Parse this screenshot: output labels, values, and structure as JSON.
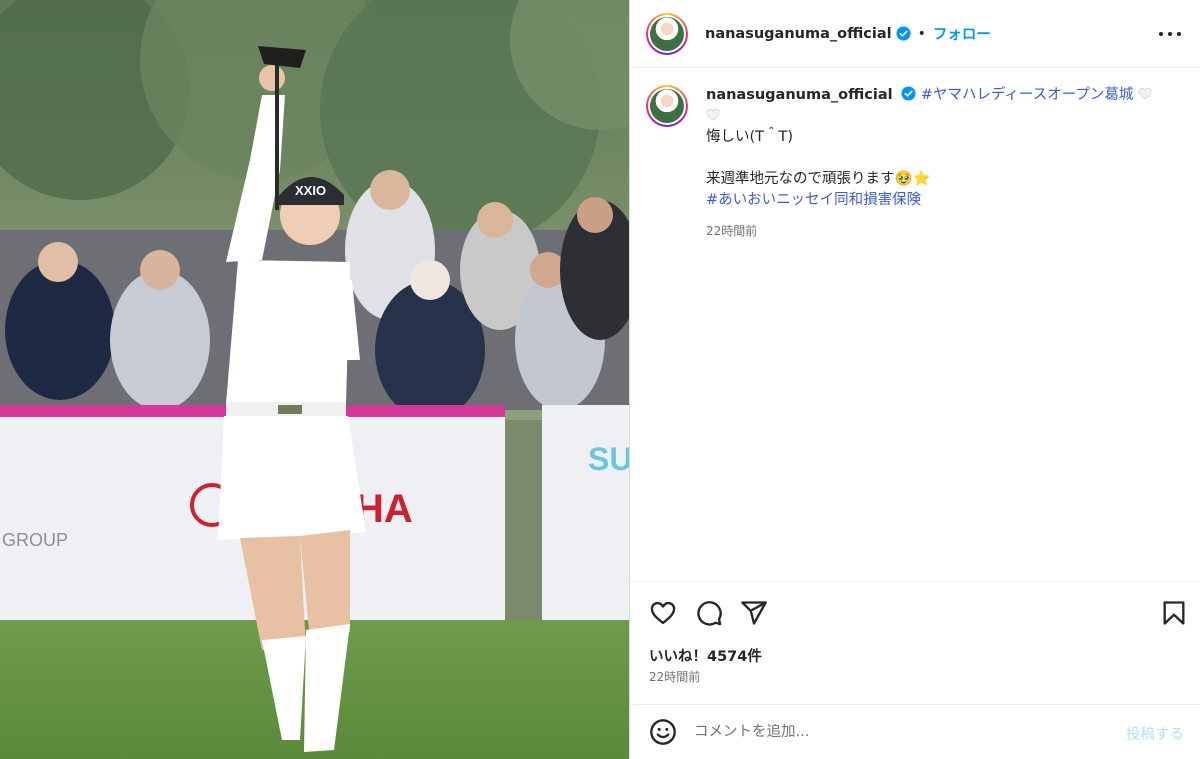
{
  "colors": {
    "accent": "#0095f6",
    "hashtag": "#3c5bd6",
    "verified": "#0095f6"
  },
  "header": {
    "username": "nanasuganuma_official",
    "separator": "•",
    "follow_label": "フォロー",
    "more_icon": "more-options-icon"
  },
  "caption": {
    "username": "nanasuganuma_official",
    "hashtag1": "#ヤマハレディースオープン葛城",
    "line1": "悔しい(T＾T)",
    "line2": "来週準地元なので頑張ります🥹⭐️",
    "hashtag2": "#あいおいニッセイ同和損害保険",
    "time": "22時間前"
  },
  "actions": {
    "like_icon": "heart-icon",
    "comment_icon": "comment-icon",
    "share_icon": "share-icon",
    "save_icon": "bookmark-icon"
  },
  "likes_label": "いいね！4574件",
  "post_time": "22時間前",
  "comment": {
    "placeholder": "コメントを追加...",
    "post_label": "投稿する",
    "emoji_icon": "emoji-icon"
  },
  "photo": {
    "alt_scene": "golfer in white raising driver in front of crowd",
    "banner_text_1": "SU",
    "banner_text_2": "HA",
    "banner_text_3": "GROUP",
    "cap_text": "XXIO"
  }
}
